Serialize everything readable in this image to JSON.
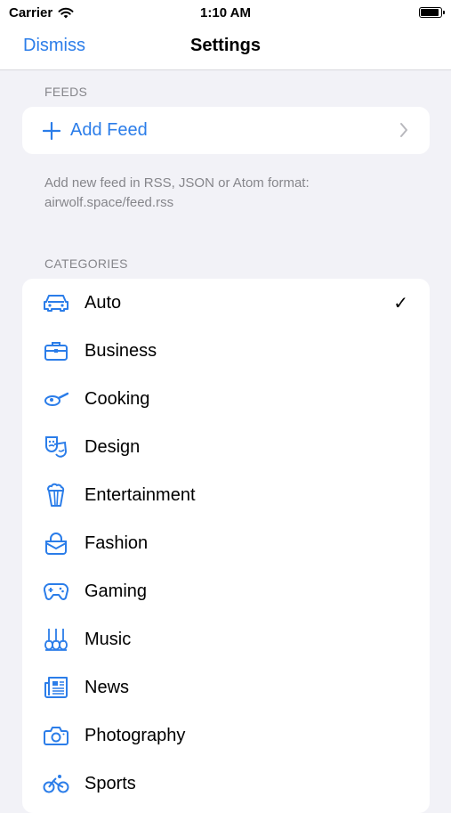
{
  "status_bar": {
    "carrier": "Carrier",
    "time": "1:10 AM",
    "icons": [
      "wifi-icon",
      "battery-icon"
    ]
  },
  "nav": {
    "dismiss_label": "Dismiss",
    "title": "Settings"
  },
  "feeds": {
    "header": "FEEDS",
    "add_feed_label": "Add Feed",
    "note_line1": "Add new feed in RSS, JSON or Atom format:",
    "note_line2": "airwolf.space/feed.rss"
  },
  "categories": {
    "header": "CATEGORIES",
    "selected_mark": "✓",
    "items": [
      {
        "label": "Auto",
        "icon": "car-icon",
        "selected": true
      },
      {
        "label": "Business",
        "icon": "briefcase-icon",
        "selected": false
      },
      {
        "label": "Cooking",
        "icon": "frying-pan-icon",
        "selected": false
      },
      {
        "label": "Design",
        "icon": "theater-masks-icon",
        "selected": false
      },
      {
        "label": "Entertainment",
        "icon": "popcorn-icon",
        "selected": false
      },
      {
        "label": "Fashion",
        "icon": "handbag-icon",
        "selected": false
      },
      {
        "label": "Gaming",
        "icon": "gamecontroller-icon",
        "selected": false
      },
      {
        "label": "Music",
        "icon": "guitars-icon",
        "selected": false
      },
      {
        "label": "News",
        "icon": "newspaper-icon",
        "selected": false
      },
      {
        "label": "Photography",
        "icon": "camera-icon",
        "selected": false
      },
      {
        "label": "Sports",
        "icon": "bicycle-icon",
        "selected": false
      }
    ]
  },
  "colors": {
    "accent": "#2b7de9",
    "background": "#f2f2f7",
    "card": "#ffffff",
    "secondary_text": "#86868b"
  }
}
